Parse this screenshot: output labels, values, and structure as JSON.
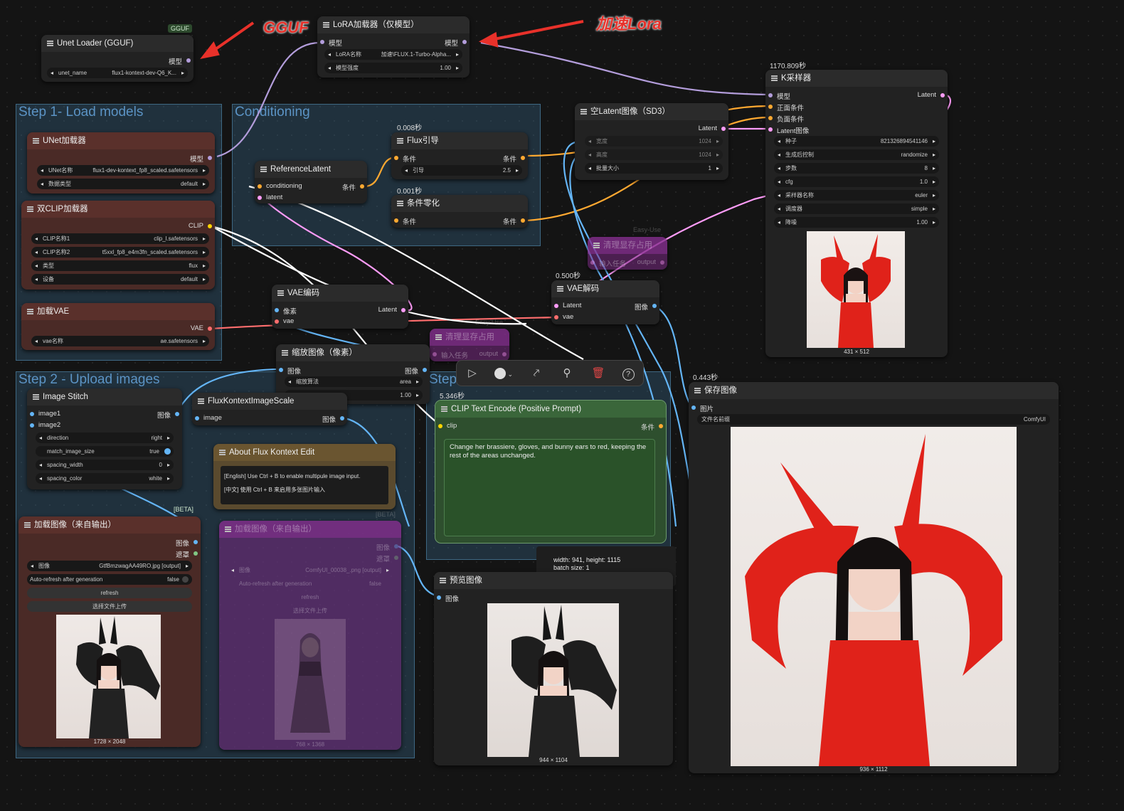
{
  "annotations": {
    "gguf": "GGUF",
    "lora": "加速Lora"
  },
  "badges": {
    "gguf": "GGUF",
    "beta": "[BETA]",
    "beta2": "[BETA]",
    "easy_use": "Easy-Use",
    "easy_use2": "Easy-Use"
  },
  "groups": {
    "step1": "Step 1- Load models",
    "conditioning": "Conditioning",
    "step2": "Step 2 - Upload images",
    "step3": "Step"
  },
  "timings": {
    "k_sampler": "1170.809秒",
    "flux_guide": "0.008秒",
    "cond_zero": "0.001秒",
    "vae_decode": "0.500秒",
    "clip_encode": "5.346秒",
    "save_image": "0.443秒"
  },
  "unet_gguf": {
    "title": "Unet Loader (GGUF)",
    "out_model": "模型",
    "w_name_k": "unet_name",
    "w_name_v": "flux1-kontext-dev-Q6_K..."
  },
  "lora": {
    "title": "LoRA加载器（仅模型）",
    "in_model": "模型",
    "out_model": "模型",
    "w1_k": "LoRA名称",
    "w1_v": "加速\\FLUX.1-Turbo-Alpha...",
    "w2_k": "模型强度",
    "w2_v": "1.00"
  },
  "unet_loader": {
    "title": "UNet加载器",
    "out_model": "模型",
    "w1_k": "UNet名称",
    "w1_v": "flux1-dev-kontext_fp8_scaled.safetensors",
    "w2_k": "数据类型",
    "w2_v": "default"
  },
  "dual_clip": {
    "title": "双CLIP加载器",
    "out": "CLIP",
    "w1_k": "CLIP名称1",
    "w1_v": "clip_l.safetensors",
    "w2_k": "CLIP名称2",
    "w2_v": "t5xxl_fp8_e4m3fn_scaled.safetensors",
    "w3_k": "类型",
    "w3_v": "flux",
    "w4_k": "设备",
    "w4_v": "default"
  },
  "vae_loader": {
    "title": "加载VAE",
    "out": "VAE",
    "w1_k": "vae名称",
    "w1_v": "ae.safetensors"
  },
  "ref_latent": {
    "title": "ReferenceLatent",
    "in1": "conditioning",
    "in2": "latent",
    "out": "条件"
  },
  "flux_guide": {
    "title": "Flux引导",
    "in": "条件",
    "out": "条件",
    "w1_k": "引导",
    "w1_v": "2.5"
  },
  "cond_zero": {
    "title": "条件零化",
    "in": "条件",
    "out": "条件"
  },
  "empty_latent": {
    "title": "空Latent图像（SD3）",
    "out": "Latent",
    "w1_k": "宽度",
    "w1_v": "1024",
    "w2_k": "高度",
    "w2_v": "1024",
    "w3_k": "批量大小",
    "w3_v": "1"
  },
  "k_sampler": {
    "title": "K采样器",
    "in1": "模型",
    "in2": "正面条件",
    "in3": "负面条件",
    "in4": "Latent图像",
    "out": "Latent",
    "widgets": [
      [
        "种子",
        "821326894541146"
      ],
      [
        "生成后控制",
        "randomize"
      ],
      [
        "步数",
        "8"
      ],
      [
        "cfg",
        "1.0"
      ],
      [
        "采样器名称",
        "euler"
      ],
      [
        "调度器",
        "simple"
      ],
      [
        "降噪",
        "1.00"
      ]
    ],
    "caption": "431 × 512"
  },
  "clean_vram": {
    "title": "清理显存占用",
    "in": "输入任务",
    "out": "output"
  },
  "clean_vram2": {
    "title": "清理显存占用",
    "in": "输入任务",
    "out": "output"
  },
  "vae_encode": {
    "title": "VAE编码",
    "in1": "像素",
    "in2": "vae",
    "out": "Latent"
  },
  "vae_decode": {
    "title": "VAE解码",
    "in1": "Latent",
    "in2": "vae",
    "out": "图像"
  },
  "scale_image": {
    "title": "缩放图像（像素）",
    "in": "图像",
    "out": "图像",
    "w1_k": "缩放算法",
    "w1_v": "area",
    "w2_v": "1.00"
  },
  "image_stitch": {
    "title": "Image Stitch",
    "in1": "image1",
    "in2": "image2",
    "out": "图像",
    "widgets": [
      [
        "direction",
        "right"
      ],
      [
        "match_image_size",
        "true"
      ],
      [
        "spacing_width",
        "0"
      ],
      [
        "spacing_color",
        "white"
      ]
    ]
  },
  "kontext_scale": {
    "title": "FluxKontextImageScale",
    "in": "image",
    "out": "图像"
  },
  "about": {
    "title": "About Flux Kontext Edit",
    "line1": "[English] Use Ctrl + B to enable multipule image input.",
    "line2": "[中文] 使用 Ctrl + B 来启用多张图片输入"
  },
  "clip_encode": {
    "title": "CLIP Text Encode (Positive Prompt)",
    "in": "clip",
    "out": "条件",
    "prompt": "Change her brassiere, gloves, and bunny ears to red, keeping the rest of the areas unchanged."
  },
  "load_image": {
    "title": "加载图像（来自输出）",
    "out1": "图像",
    "out2": "遮罩",
    "w1_k": "图像",
    "w1_v": "GtfBmzwagAA49RO.jpg [output]",
    "w2_k": "Auto-refresh after generation",
    "w2_v": "false",
    "btn1": "refresh",
    "btn2": "选择文件上传",
    "caption": "1728 × 2048"
  },
  "load_image_ghost": {
    "title": "加载图像（来自输出）",
    "out1": "图像",
    "out2": "遮罩",
    "w1_k": "图像",
    "w1_v": "ComfyUI_00038_.png [output]",
    "w2_k": "Auto-refresh after generation",
    "w2_v": "false",
    "btn1": "refresh",
    "btn2": "选择文件上传",
    "caption": "768 × 1368"
  },
  "preview": {
    "title": "预览图像",
    "in": "图像",
    "caption": "944 × 1104"
  },
  "size_info": {
    "line1": "width: 941, height: 1115",
    "line2": "batch size: 1"
  },
  "save_image": {
    "title": "保存图像",
    "in": "图片",
    "w1_k": "文件名前缀",
    "w1_v": "ComfyUI",
    "caption": "936 × 1112"
  },
  "toolbar": {
    "icons": [
      "play-icon",
      "color-circle-icon",
      "bypass-icon",
      "pin-icon",
      "delete-icon",
      "help-icon"
    ],
    "delete_color": "#e04646"
  },
  "colors": {
    "model": "#b39ddb",
    "clip": "#ffd500",
    "vae": "#ff6e6e",
    "cond": "#ffa931",
    "latent": "#ff9cf9",
    "image": "#64b5f6",
    "mask": "#81c784"
  }
}
